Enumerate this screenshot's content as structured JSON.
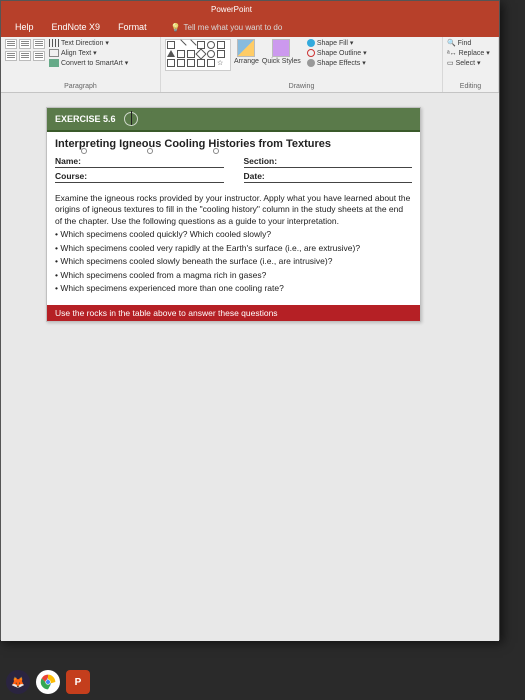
{
  "titlebar": {
    "appTitle": "PowerPoint"
  },
  "tabs": {
    "items": [
      {
        "label": "Help"
      },
      {
        "label": "EndNote X9"
      },
      {
        "label": "Format"
      }
    ],
    "tellMe": "Tell me what you want to do"
  },
  "ribbon": {
    "paragraph": {
      "label": "Paragraph",
      "textDirection": "Text Direction",
      "alignText": "Align Text",
      "convertSmartArt": "Convert to SmartArt"
    },
    "drawing": {
      "label": "Drawing",
      "arrange": "Arrange",
      "quickStyles": "Quick Styles",
      "shapeFill": "Shape Fill",
      "shapeOutline": "Shape Outline",
      "shapeEffects": "Shape Effects"
    },
    "editing": {
      "label": "Editing",
      "find": "Find",
      "replace": "Replace",
      "select": "Select"
    }
  },
  "doc": {
    "exercise": "EXERCISE 5.6",
    "heading": "Interpreting Igneous Cooling Histories from Textures",
    "nameLabel": "Name:",
    "sectionLabel": "Section:",
    "courseLabel": "Course:",
    "dateLabel": "Date:",
    "intro": "Examine the igneous rocks provided by your instructor. Apply what you have learned about the origins of igneous textures to fill in the \"cooling history\" column in the study sheets at the end of the chapter. Use the following questions as a guide to your interpretation.",
    "q1": "• Which specimens cooled quickly? Which cooled slowly?",
    "q2": "• Which specimens cooled very rapidly at the Earth's surface (i.e., are extrusive)?",
    "q3": "• Which specimens cooled slowly beneath the surface (i.e., are intrusive)?",
    "q4": "• Which specimens cooled from a magma rich in gases?",
    "q5": "• Which specimens experienced more than one cooling rate?",
    "redbar": "Use the rocks in the table above to answer these questions"
  },
  "colors": {
    "accent": "#b7402a",
    "green": "#5a7a4a",
    "red": "#b52025"
  }
}
